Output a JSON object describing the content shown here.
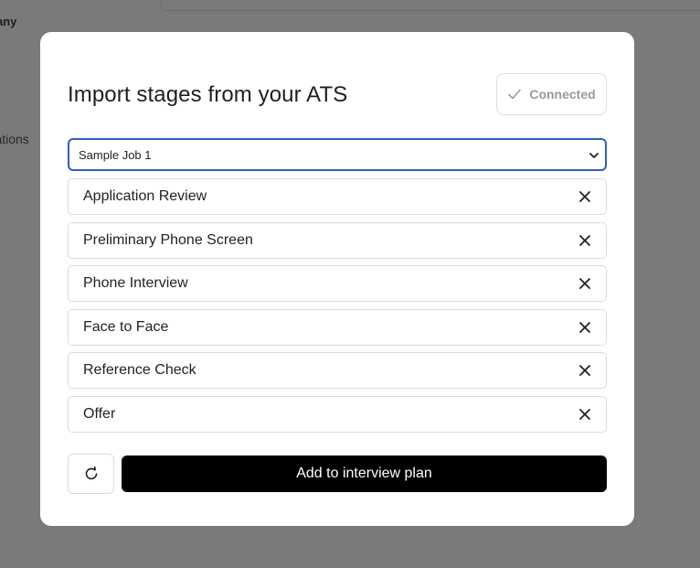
{
  "background": {
    "company_label": "pany",
    "integrations_label": "grations"
  },
  "modal": {
    "title": "Import stages from your ATS",
    "connected_label": "Connected",
    "job_select": {
      "selected": "Sample Job 1"
    },
    "stages": [
      {
        "label": "Application Review"
      },
      {
        "label": "Preliminary Phone Screen"
      },
      {
        "label": "Phone Interview"
      },
      {
        "label": "Face to Face"
      },
      {
        "label": "Reference Check"
      },
      {
        "label": "Offer"
      }
    ],
    "add_button_label": "Add to interview plan"
  },
  "icons": {
    "connected": "check-icon",
    "select": "chevron-down-icon",
    "remove": "close-icon",
    "refresh": "refresh-icon"
  },
  "colors": {
    "select_border": "#2f5fbf",
    "primary_button": "#000000",
    "badge_text": "#9a9a9a"
  }
}
